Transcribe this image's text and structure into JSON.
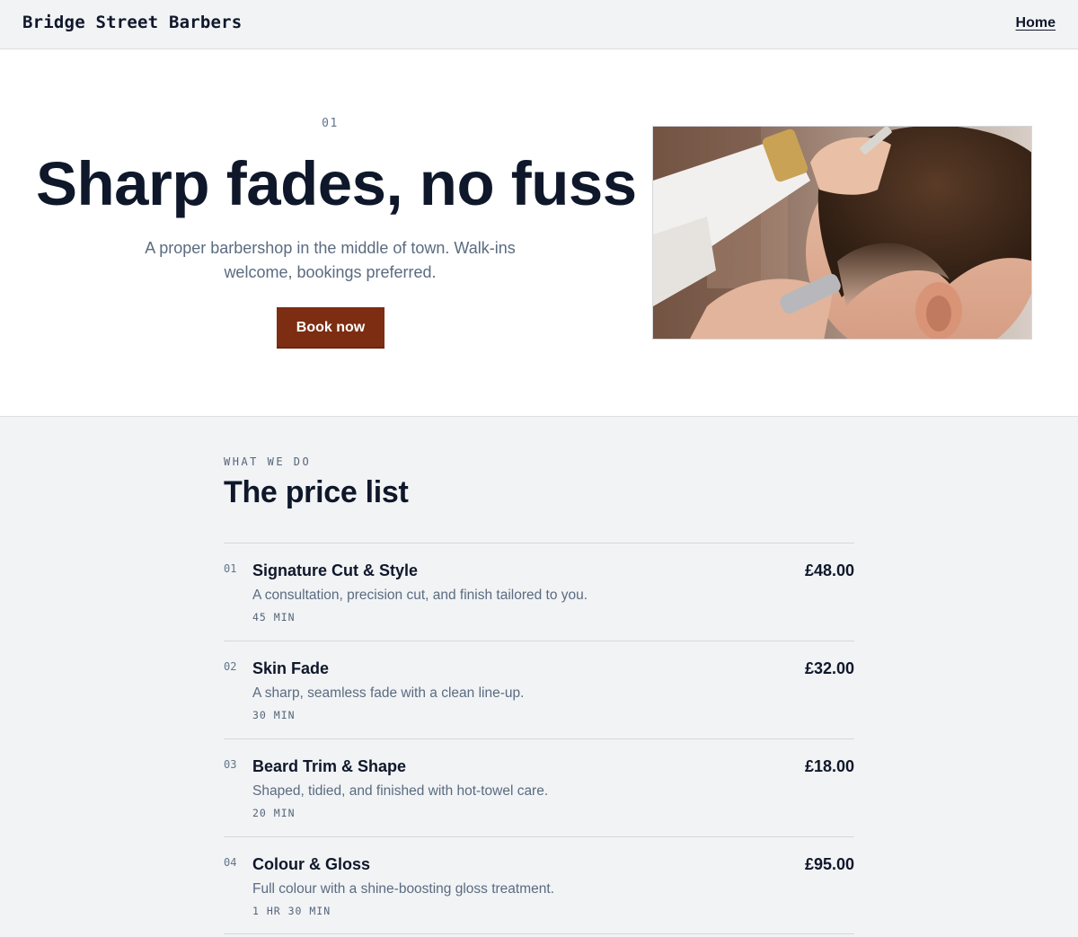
{
  "header": {
    "brand": "Bridge Street Barbers",
    "nav": {
      "home": "Home"
    }
  },
  "hero": {
    "number": "01",
    "title": "Sharp fades, no fuss",
    "subtitle": "A proper barbershop in the middle of town. Walk-ins welcome, bookings preferred.",
    "cta": "Book now",
    "photo_icon": "barber-cutting-hair-photo"
  },
  "prices": {
    "eyebrow": "WHAT WE DO",
    "title": "The price list",
    "items": [
      {
        "num": "01",
        "name": "Signature Cut & Style",
        "desc": "A consultation, precision cut, and finish tailored to you.",
        "duration": "45 MIN",
        "price": "£48.00"
      },
      {
        "num": "02",
        "name": "Skin Fade",
        "desc": "A sharp, seamless fade with a clean line-up.",
        "duration": "30 MIN",
        "price": "£32.00"
      },
      {
        "num": "03",
        "name": "Beard Trim & Shape",
        "desc": "Shaped, tidied, and finished with hot-towel care.",
        "duration": "20 MIN",
        "price": "£18.00"
      },
      {
        "num": "04",
        "name": "Colour & Gloss",
        "desc": "Full colour with a shine-boosting gloss treatment.",
        "duration": "1 HR 30 MIN",
        "price": "£95.00"
      }
    ]
  },
  "colors": {
    "accent": "#7c2d12",
    "text": "#0f172a",
    "muted": "#5b6b80",
    "background": "#f1f3f5"
  }
}
